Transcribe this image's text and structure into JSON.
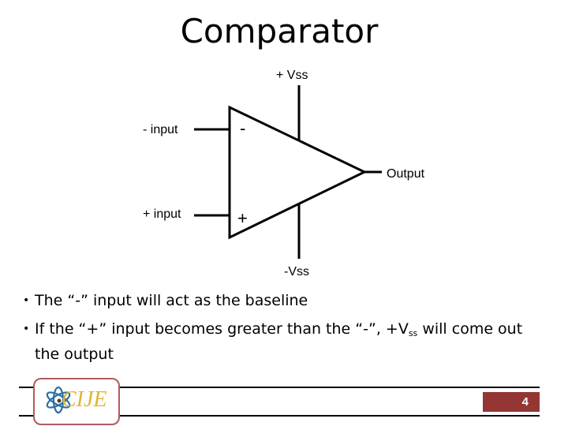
{
  "slide": {
    "title": "Comparator",
    "page_number": "4"
  },
  "diagram": {
    "labels": {
      "plus_vss": "+ Vss",
      "minus_vss": "-Vss",
      "minus_input": "- input",
      "plus_input": "+ input",
      "output": "Output",
      "minus_sign": "-",
      "plus_sign": "+"
    }
  },
  "bullets": [
    {
      "text": "The “-” input will act as the baseline"
    },
    {
      "text_before": "If the “+” input becomes greater than the “-”, +V",
      "subscript": "ss",
      "text_after": " will come out the output"
    }
  ],
  "footer": {
    "logo_text": "CIJE",
    "colors": {
      "logo_border": "#b05a5a",
      "logo_text": "#e0b43a",
      "logo_atom": "#2a6fa8",
      "page_badge": "#943634"
    }
  }
}
